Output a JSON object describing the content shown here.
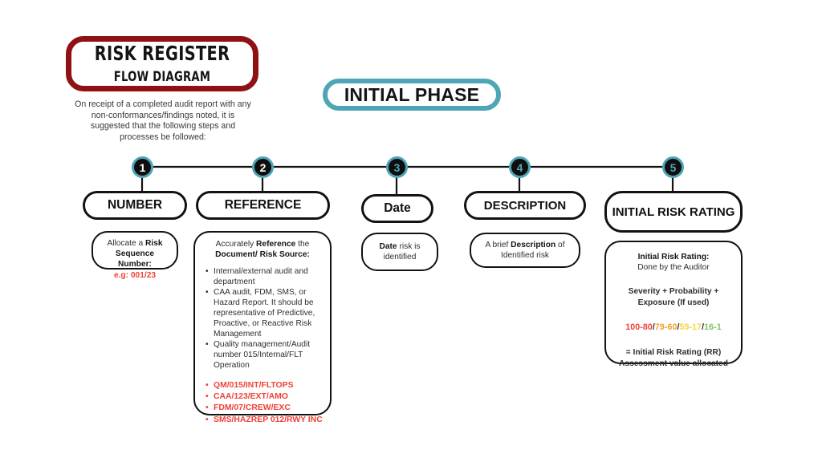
{
  "title_card": {
    "main": "RISK REGISTER",
    "sub": "FLOW DIAGRAM",
    "border_color": "#8f1114"
  },
  "intro": {
    "text": "On receipt of a completed audit report with any non-conformances/findings noted, it is suggested that the following steps and processes be followed:"
  },
  "phase_badge": {
    "label": "INITIAL PHASE",
    "border_color": "#4ea5b5"
  },
  "theme": {
    "accent_teal": "#4ea5b5",
    "ink": "#121212",
    "red": "#ef4136",
    "background": "#ffffff"
  },
  "steps": [
    {
      "number": "1",
      "number_color": "#ffffff",
      "heading": "NUMBER",
      "detail": {
        "line1_plain": "Allocate a ",
        "line1_bold": "Risk",
        "line2_bold": "Sequence Number:",
        "example": "e.g: 001/23",
        "example_color": "#ef4136"
      }
    },
    {
      "number": "2",
      "number_color": "#ffffff",
      "heading": "REFERENCE",
      "detail": {
        "intro_plain_1": "Accurately ",
        "intro_bold_1": "Reference",
        "intro_plain_2": " the",
        "intro_bold_2": "Document/ Risk Source:",
        "bullets": [
          "Internal/external audit and department",
          "CAA audit, FDM, SMS, or Hazard Report. It should be representative of Predictive, Proactive, or Reactive Risk Management",
          "Quality management/Audit number 015/Internal/FLT Operation"
        ],
        "red_bullets": [
          "QM/015/INT/FLTOPS",
          "CAA/123/EXT/AMO",
          "FDM/07/CREW/EXC",
          "SMS/HAZREP 012/RWY INC"
        ]
      }
    },
    {
      "number": "3",
      "number_color": "#4ea5b5",
      "heading": "Date",
      "detail": {
        "bold_lead": "Date",
        "rest": " risk is identified"
      }
    },
    {
      "number": "4",
      "number_color": "#4ea5b5",
      "heading": "DESCRIPTION",
      "detail": {
        "plain_lead": "A brief ",
        "bold_word": "Description",
        "rest": " of Identified risk"
      }
    },
    {
      "number": "5",
      "number_color": "#4ea5b5",
      "heading": "INITIAL RISK RATING",
      "detail": {
        "heading_bold": "Initial Risk Rating:",
        "subheading": "Done by the Auditor",
        "formula": "Severity + Probability + Exposure (If used)",
        "scale": [
          {
            "range": "100-80",
            "color": "#ef4136"
          },
          {
            "range": "79-60",
            "color": "#f0a02e"
          },
          {
            "range": "59-17",
            "color": "#f5d547"
          },
          {
            "range": "16-1",
            "color": "#7dc45f"
          }
        ],
        "scale_separator": "/",
        "footer_line1": "= Initial Risk Rating (RR)",
        "footer_line2": "Assessment value allocated"
      }
    }
  ]
}
